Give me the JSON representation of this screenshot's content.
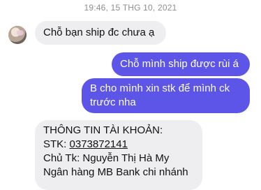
{
  "timestamp": "19:46, 15 THG 10, 2021",
  "messages": [
    {
      "sender": "other",
      "lines": [
        "Chỗ bạn ship đc chưa ạ"
      ]
    },
    {
      "sender": "me",
      "lines": [
        "Chỗ mình ship được rùi á"
      ]
    },
    {
      "sender": "me",
      "lines": [
        "B cho mình xin stk để mình ck",
        "trước nha"
      ]
    },
    {
      "sender": "other",
      "lines": [
        "THÔNG TIN TÀI KHOẢN:",
        "STK: ",
        "Chủ Tk: Nguyễn Thị Hà My",
        "Ngân hàng MB Bank chi nhánh"
      ],
      "account_number": "0373872141"
    }
  ]
}
